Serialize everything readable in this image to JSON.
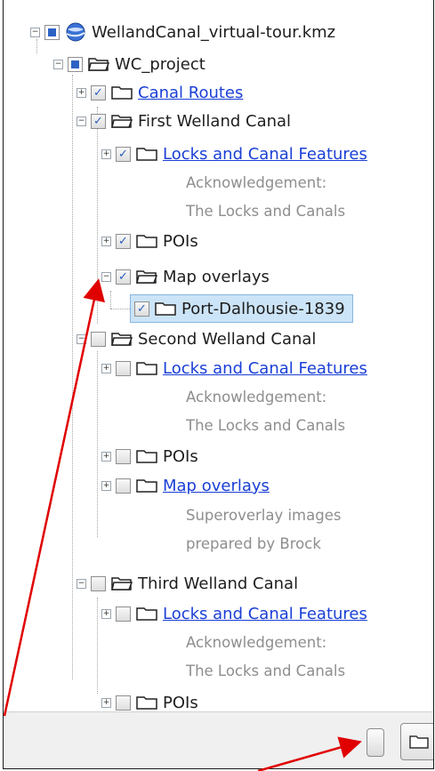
{
  "tree": {
    "root": {
      "label": "WellandCanal_virtual-tour.kmz",
      "expander": "−"
    },
    "project": {
      "label": "WC_project",
      "expander": "−"
    },
    "canal_routes": {
      "label": "Canal Routes",
      "expander": "+",
      "check": "✓"
    },
    "first": {
      "label": "First Welland Canal",
      "expander": "−",
      "check": "✓",
      "locks": {
        "label": "Locks and Canal Features",
        "expander": "+",
        "check": "✓",
        "desc1": "Acknowledgement:",
        "desc2": "The Locks and Canals"
      },
      "pois": {
        "label": "POIs",
        "expander": "+",
        "check": "✓"
      },
      "map_overlays": {
        "label": "Map overlays",
        "expander": "−",
        "check": "✓",
        "child": {
          "label": "Port-Dalhousie-1839",
          "check": "✓"
        }
      }
    },
    "second": {
      "label": "Second Welland Canal",
      "expander": "−",
      "check": "",
      "locks": {
        "label": "Locks and Canal Features",
        "expander": "+",
        "check": "",
        "desc1": "Acknowledgement:",
        "desc2": "The Locks and Canals"
      },
      "pois": {
        "label": "POIs",
        "expander": "+",
        "check": ""
      },
      "map_overlays": {
        "label": "Map overlays",
        "expander": "+",
        "check": "",
        "desc1": "Superoverlay images",
        "desc2": "prepared by Brock"
      }
    },
    "third": {
      "label": "Third Welland Canal",
      "expander": "−",
      "check": "",
      "locks": {
        "label": "Locks and Canal Features",
        "expander": "+",
        "check": "",
        "desc1": "Acknowledgement:",
        "desc2": "The Locks and Canals"
      },
      "pois": {
        "label": "POIs",
        "expander": "+",
        "check": ""
      }
    }
  },
  "colors": {
    "link": "#1a3fd6",
    "description": "#8e8e8e",
    "selection": "#cce4f7",
    "checkbox_fill": "#2c62c4",
    "annotation_arrow": "#e00000"
  },
  "icons": {
    "globe": "globe-icon",
    "folder_open": "folder-open-icon",
    "folder_closed": "folder-closed-icon",
    "expander": "plus-minus-expander-icon",
    "transparency_slider": "slider-thumb-icon",
    "folder_button": "folder-button-icon"
  }
}
